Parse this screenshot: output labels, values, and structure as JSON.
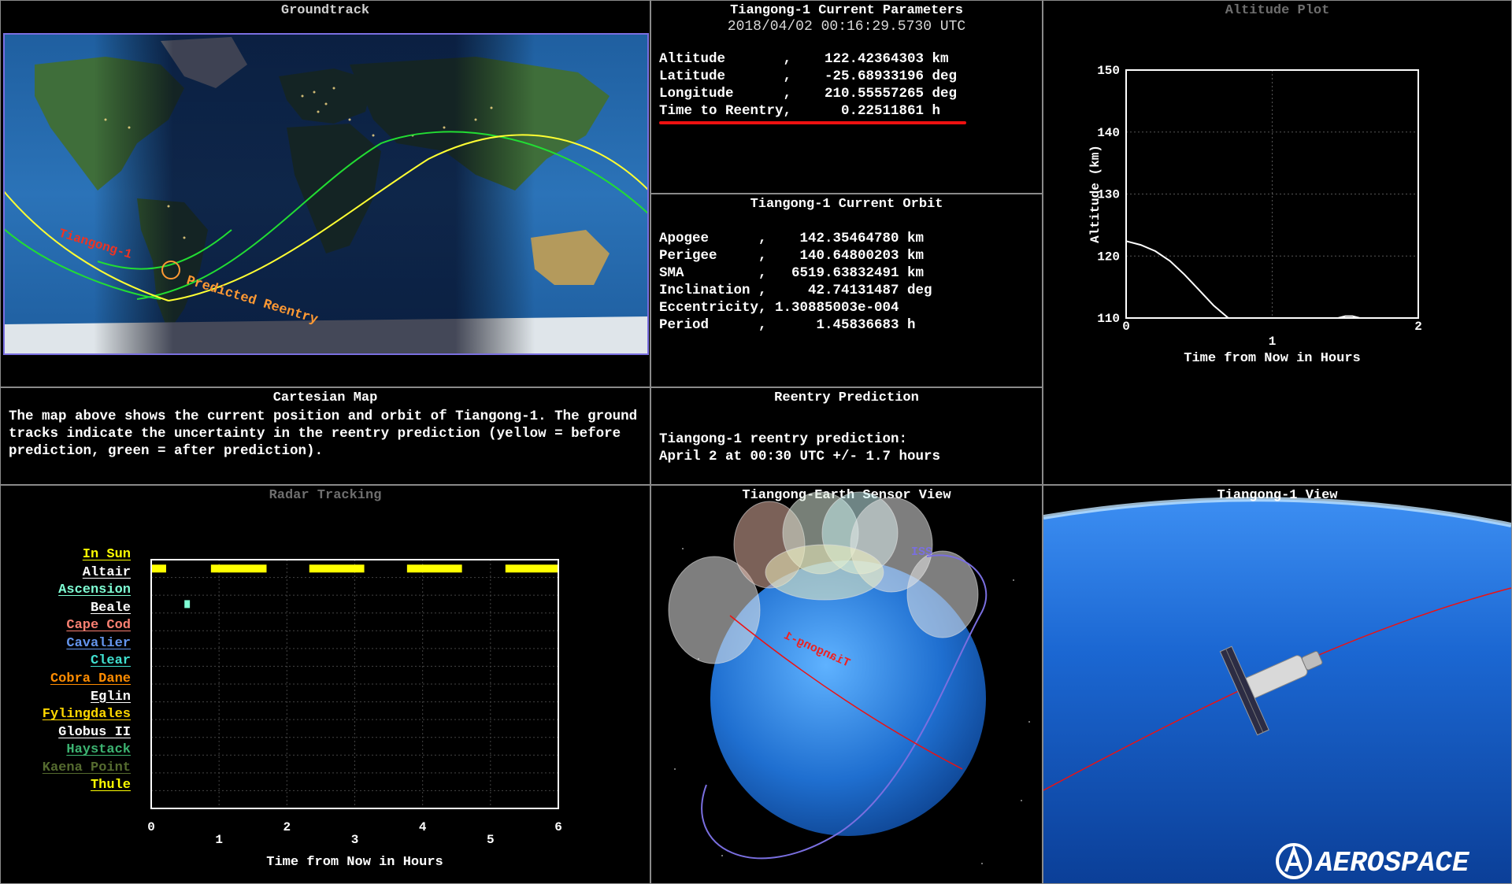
{
  "groundtrack": {
    "title": "Groundtrack",
    "sat_label": "Tiangong-1",
    "reentry_label": "Predicted Reentry"
  },
  "params": {
    "title_line1": "Tiangong-1 Current Parameters",
    "title_line2": "2018/04/02 00:16:29.5730 UTC",
    "rows": [
      "Altitude       ,    122.42364303 km",
      "Latitude       ,    -25.68933196 deg",
      "Longitude      ,    210.55557265 deg",
      "Time to Reentry,      0.22511861 h"
    ]
  },
  "orbit": {
    "title": "Tiangong-1 Current Orbit",
    "rows": [
      "Apogee      ,    142.35464780 km",
      "Perigee     ,    140.64800203 km",
      "SMA         ,   6519.63832491 km",
      "Inclination ,     42.74131487 deg",
      "Eccentricity, 1.30885003e-004",
      "Period      ,      1.45836683 h"
    ]
  },
  "cartesian": {
    "title": "Cartesian Map",
    "text": "The map above shows the current position and orbit of Tiangong-1. The ground tracks indicate the uncertainty in the reentry prediction (yellow = before prediction, green = after prediction)."
  },
  "reentry": {
    "title": "Reentry Prediction",
    "line1": "Tiangong-1 reentry prediction:",
    "line2": "April 2 at 00:30 UTC +/- 1.7 hours"
  },
  "altitude_plot": {
    "title": "Altitude Plot",
    "chart_data": {
      "type": "line",
      "xlabel": "Time from Now in Hours",
      "ylabel": "Altitude (km)",
      "xlim": [
        0,
        2
      ],
      "ylim": [
        110,
        150
      ],
      "x_ticks": [
        "0",
        "1",
        "2"
      ],
      "y_ticks": [
        "110",
        "120",
        "130",
        "140",
        "150"
      ],
      "grid": true,
      "series": [
        {
          "x": [
            0,
            0.1,
            0.2,
            0.3,
            0.4,
            0.5,
            0.6,
            0.7
          ],
          "y": [
            122.4,
            121.8,
            120.8,
            119.2,
            117.0,
            114.5,
            112.0,
            110.0
          ]
        },
        {
          "x": [
            1.45,
            1.5,
            1.55,
            1.6
          ],
          "y": [
            110.0,
            110.3,
            110.3,
            110.0
          ]
        }
      ]
    }
  },
  "radar": {
    "title": "Radar Tracking",
    "stations": [
      {
        "name": "In Sun",
        "color": "#ffff00"
      },
      {
        "name": "Altair",
        "color": "#ffffff"
      },
      {
        "name": "Ascension",
        "color": "#7fffd4"
      },
      {
        "name": "Beale",
        "color": "#ffffff"
      },
      {
        "name": "Cape Cod",
        "color": "#fa8072"
      },
      {
        "name": "Cavalier",
        "color": "#6495ed"
      },
      {
        "name": "Clear",
        "color": "#40e0d0"
      },
      {
        "name": "Cobra Dane",
        "color": "#ff8c00"
      },
      {
        "name": "Eglin",
        "color": "#ffffff"
      },
      {
        "name": "Fylingdales",
        "color": "#ffd700"
      },
      {
        "name": "Globus II",
        "color": "#ffffff"
      },
      {
        "name": "Haystack",
        "color": "#3cb371"
      },
      {
        "name": "Kaena Point",
        "color": "#556b2f"
      },
      {
        "name": "Thule",
        "color": "#ffff00"
      }
    ],
    "chart_data": {
      "type": "bar",
      "xlabel": "Time from Now in Hours",
      "xlim": [
        0,
        6
      ],
      "x_ticks": [
        "0",
        "1",
        "2",
        "3",
        "4",
        "5",
        "6"
      ],
      "intervals": [
        {
          "station": "In Sun",
          "start": 0.0,
          "end": 0.22
        },
        {
          "station": "In Sun",
          "start": 0.88,
          "end": 1.7
        },
        {
          "station": "In Sun",
          "start": 2.33,
          "end": 3.14
        },
        {
          "station": "In Sun",
          "start": 3.77,
          "end": 4.58
        },
        {
          "station": "In Sun",
          "start": 5.22,
          "end": 6.0
        },
        {
          "station": "Ascension",
          "start": 0.49,
          "end": 0.57
        }
      ]
    }
  },
  "sensor_view": {
    "title": "Tiangong-Earth Sensor View",
    "sat_label": "Tiangong-1",
    "iss_label": "ISS"
  },
  "tiangong_view": {
    "title": "Tiangong-1 View",
    "logo_text": "AEROSPACE"
  },
  "colors": {
    "yellow_track": "#ffff33",
    "green_track": "#22dd33",
    "orange": "#ff9933",
    "red": "#ee1111"
  }
}
